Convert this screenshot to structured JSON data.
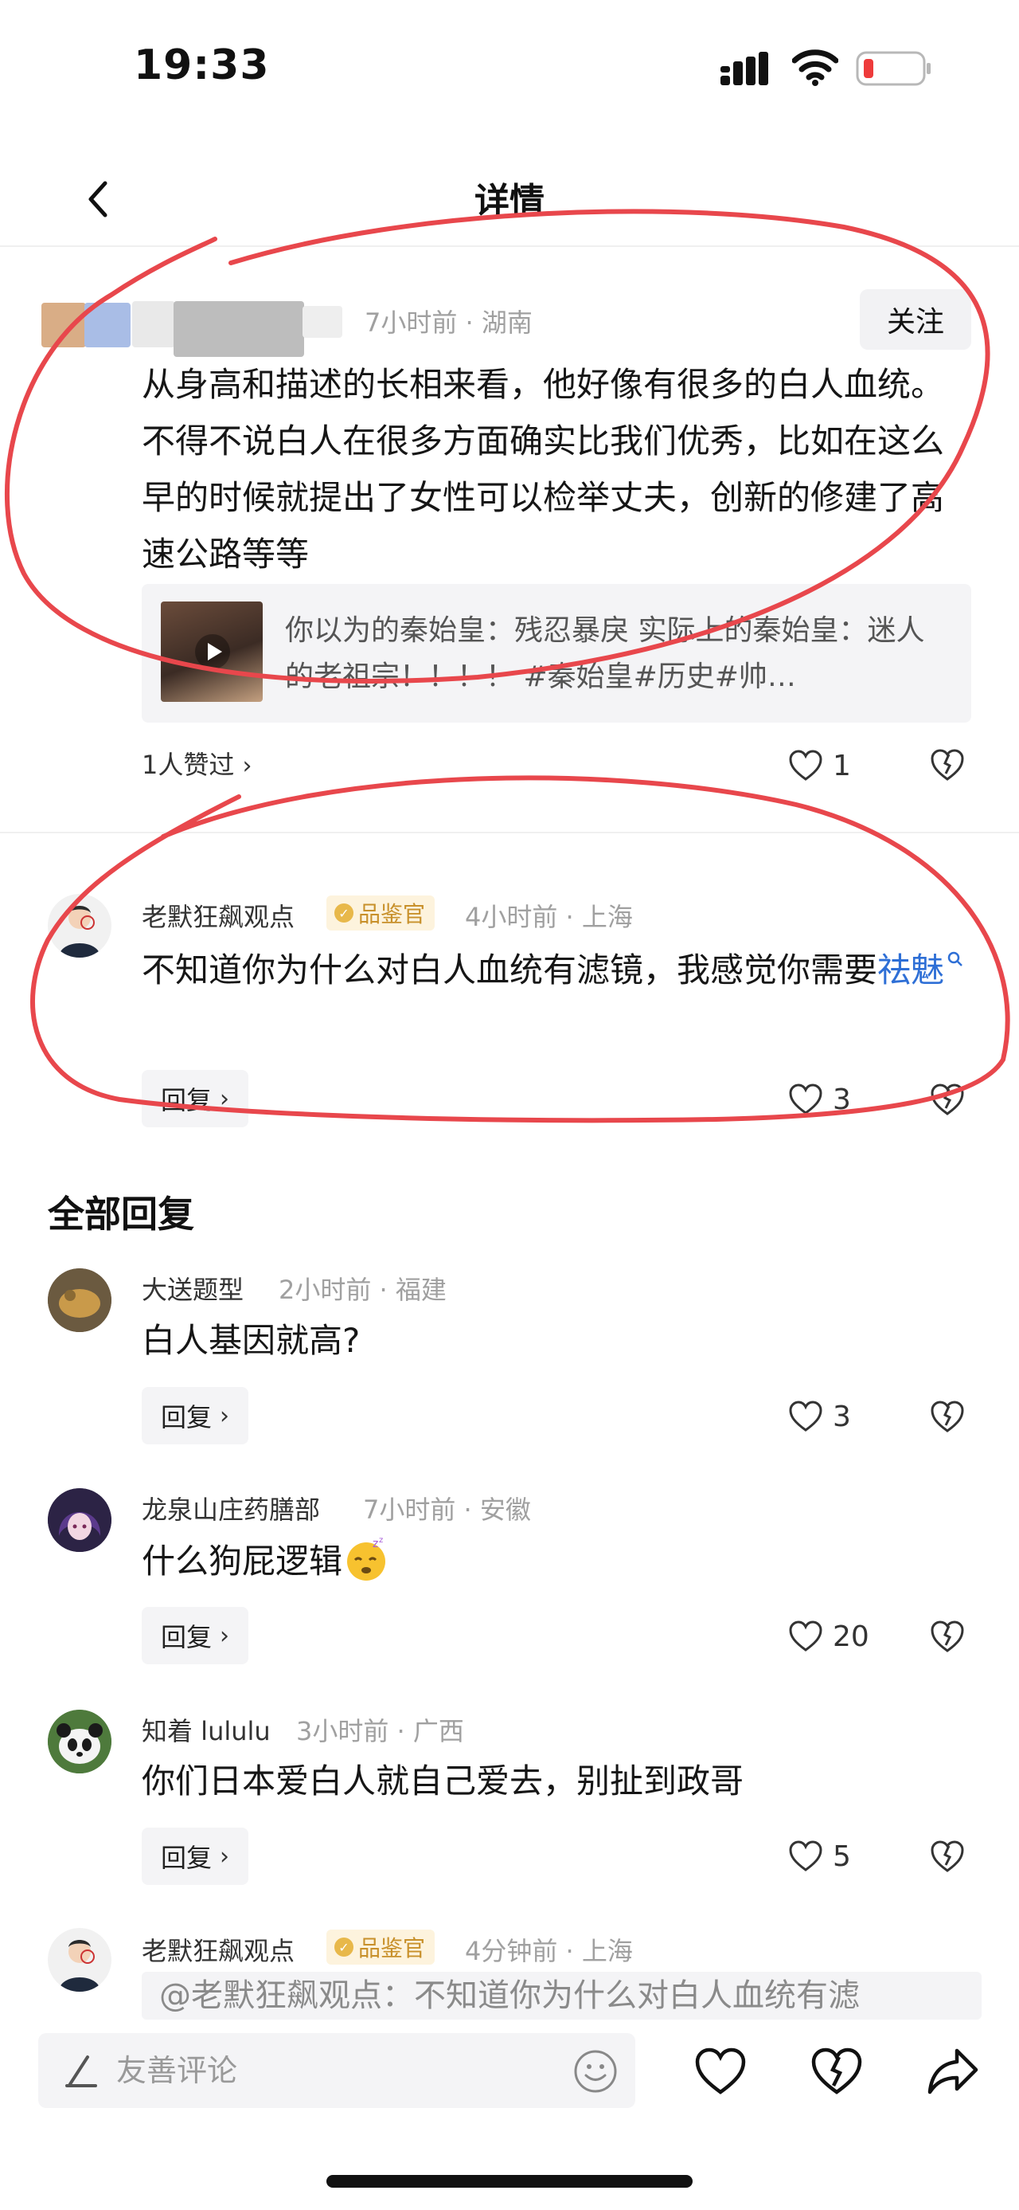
{
  "status_bar": {
    "time": "19:33"
  },
  "nav": {
    "title": "详情"
  },
  "main_comment": {
    "time_location": "7小时前 · 湖南",
    "follow_label": "关注",
    "content": "从身高和描述的长相来看，他好像有很多的白人血统。不得不说白人在很多方面确实比我们优秀，比如在这么早的时候就提出了女性可以检举丈夫，创新的修建了高速公路等等",
    "video_text": "你以为的秦始皇：残忍暴戾 实际上的秦始皇：迷人的老祖宗！！！！ #秦始皇#历史#帅…",
    "likers_label": "1人赞过",
    "like_count": "1"
  },
  "featured_reply": {
    "name": "老默狂飙观点",
    "badge": "品鉴官",
    "time_location": "4小时前 · 上海",
    "content": "不知道你为什么对白人血统有滤镜，我感觉你需要",
    "link_word": "祛魅",
    "reply_label": "回复",
    "like_count": "3"
  },
  "section_title": "全部回复",
  "replies": [
    {
      "name": "大送题型",
      "time_location": "2小时前 · 福建",
      "content": "白人基因就高?",
      "reply_label": "回复",
      "like_count": "3"
    },
    {
      "name": "龙泉山庄药膳部",
      "time_location": "7小时前 · 安徽",
      "content": "什么狗屁逻辑",
      "reply_label": "回复",
      "like_count": "20"
    },
    {
      "name": "知着 lululu",
      "time_location": "3小时前 · 广西",
      "content": "你们日本爱白人就自己爱去，别扯到政哥",
      "reply_label": "回复",
      "like_count": "5"
    }
  ],
  "last_reply": {
    "name": "老默狂飙观点",
    "badge": "品鉴官",
    "time_location": "4分钟前 · 上海",
    "quoted": "@老默狂飙观点：不知道你为什么对白人血统有滤"
  },
  "bottom_bar": {
    "placeholder": "友善评论"
  },
  "colors": {
    "annotation_red": "#e8474c",
    "link_blue": "#2e6fd6",
    "badge_gold": "#c8902a"
  }
}
